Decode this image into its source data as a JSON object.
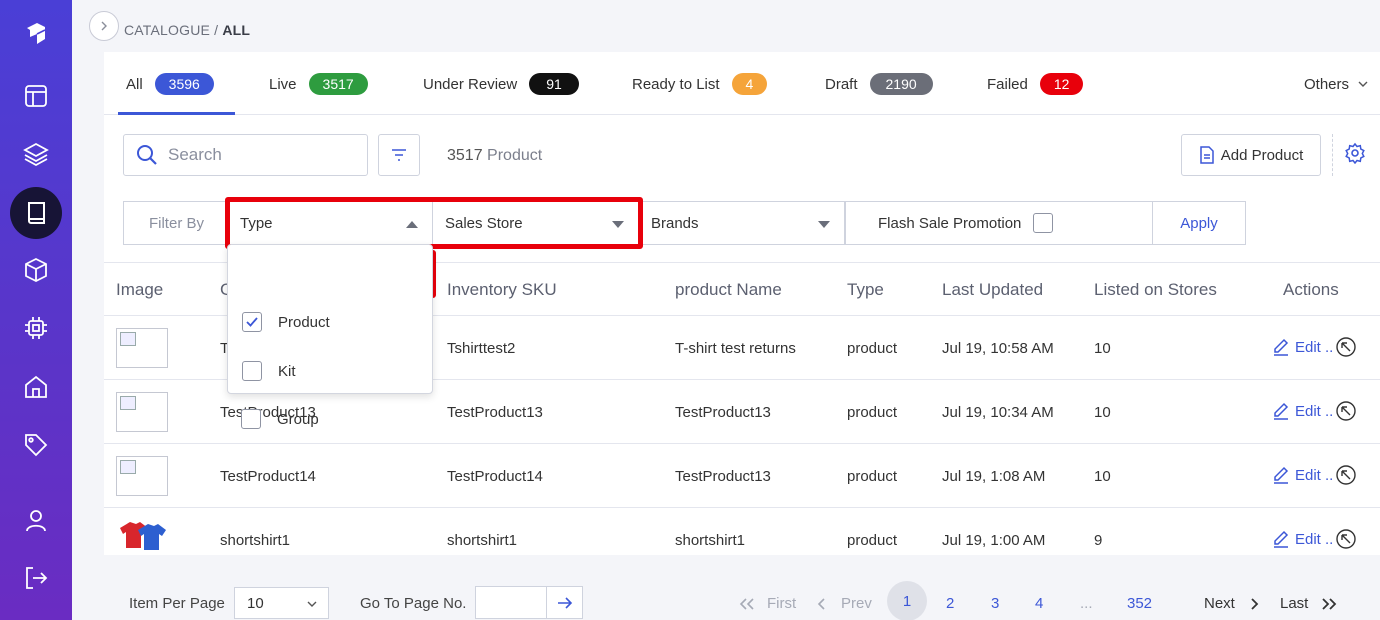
{
  "breadcrumb": {
    "parent": "CATALOGUE / ",
    "current": "ALL"
  },
  "tabs": [
    {
      "label": "All",
      "count": "3596",
      "color": "#3c57d7"
    },
    {
      "label": "Live",
      "count": "3517",
      "color": "#2e9c3f"
    },
    {
      "label": "Under Review",
      "count": "91",
      "color": "#111111"
    },
    {
      "label": "Ready to List",
      "count": "4",
      "color": "#f5a43a"
    },
    {
      "label": "Draft",
      "count": "2190",
      "color": "#6b6e78"
    },
    {
      "label": "Failed",
      "count": "12",
      "color": "#e8000b"
    }
  ],
  "others_label": "Others",
  "search": {
    "placeholder": "Search"
  },
  "product_count": {
    "number": "3517",
    "label": " Product"
  },
  "add_product_label": "Add Product",
  "filters": {
    "filter_by": "Filter By",
    "type": "Type",
    "sales_store": "Sales Store",
    "brands": "Brands",
    "flash_sale": "Flash Sale Promotion",
    "apply": "Apply"
  },
  "type_options": [
    {
      "label": "Product",
      "checked": true
    },
    {
      "label": "Kit",
      "checked": false
    },
    {
      "label": "Group",
      "checked": false
    }
  ],
  "columns": [
    "Image",
    "G",
    "Inventory SKU",
    "product Name",
    "Type",
    "Last Updated",
    "Listed on Stores",
    "Actions"
  ],
  "rows": [
    {
      "group": "T",
      "sku": "Tshirttest2",
      "name": "T-shirt test returns",
      "type": "product",
      "updated": "Jul 19, 10:58 AM",
      "listed": "10",
      "image": "placeholder"
    },
    {
      "group": "TestProduct13",
      "sku": "TestProduct13",
      "name": "TestProduct13",
      "type": "product",
      "updated": "Jul 19, 10:34 AM",
      "listed": "10",
      "image": "placeholder"
    },
    {
      "group": "TestProduct14",
      "sku": "TestProduct14",
      "name": "TestProduct13",
      "type": "product",
      "updated": "Jul 19, 1:08 AM",
      "listed": "10",
      "image": "placeholder"
    },
    {
      "group": "shortshirt1",
      "sku": "shortshirt1",
      "name": "shortshirt1",
      "type": "product",
      "updated": "Jul 19, 1:00 AM",
      "listed": "9",
      "image": "shirt"
    }
  ],
  "edit_label": "Edit ..",
  "pagination": {
    "item_per_page_label": "Item Per Page",
    "item_per_page_value": "10",
    "goto_label": "Go To Page No.",
    "first": "First",
    "prev": "Prev",
    "pages": [
      "1",
      "2",
      "3",
      "4"
    ],
    "ellipsis": "...",
    "last_page": "352",
    "next": "Next",
    "last": "Last"
  }
}
